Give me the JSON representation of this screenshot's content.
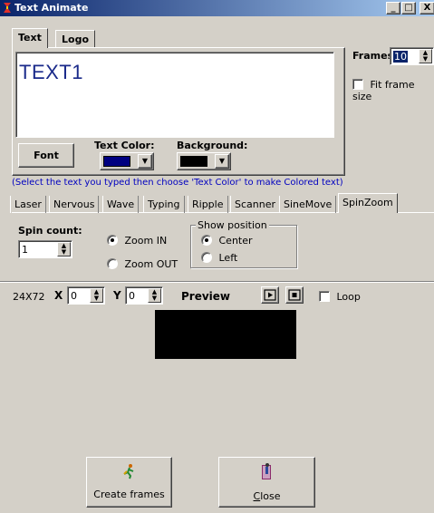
{
  "window": {
    "title": "Text Animate",
    "min": "_",
    "max": "□",
    "close": "X"
  },
  "top_tabs": [
    {
      "label": "Text"
    },
    {
      "label": "Logo"
    }
  ],
  "text_editor": {
    "value": "TEXT1",
    "text_color": "#1a2a8a"
  },
  "frames": {
    "label": "Frames",
    "value": "10"
  },
  "fit_frame": {
    "label": "Fit frame size",
    "checked": false
  },
  "font_button": "Font",
  "text_color": {
    "label": "Text Color:",
    "swatch": "#000080"
  },
  "background": {
    "label": "Background:",
    "swatch": "#000000"
  },
  "hint": "(Select the text you typed then choose 'Text Color' to make Colored text)",
  "effect_tabs": [
    {
      "label": "Laser"
    },
    {
      "label": "Nervous"
    },
    {
      "label": "Wave"
    },
    {
      "label": "Typing"
    },
    {
      "label": "Ripple"
    },
    {
      "label": "Scanner"
    },
    {
      "label": "SineMove"
    },
    {
      "label": "SpinZoom"
    }
  ],
  "spin": {
    "count_label": "Spin count:",
    "count_value": "1",
    "zoom_in": "Zoom IN",
    "zoom_out": "Zoom OUT",
    "show_position": {
      "label": "Show position",
      "center": "Center",
      "left": "Left"
    }
  },
  "preview": {
    "size": "24X72",
    "x_label": "X",
    "x_value": "0",
    "y_label": "Y",
    "y_value": "0",
    "label": "Preview",
    "loop": "Loop"
  },
  "actions": {
    "create": "Create frames",
    "close": "Close",
    "close_underline": "C",
    "close_rest": "lose"
  }
}
